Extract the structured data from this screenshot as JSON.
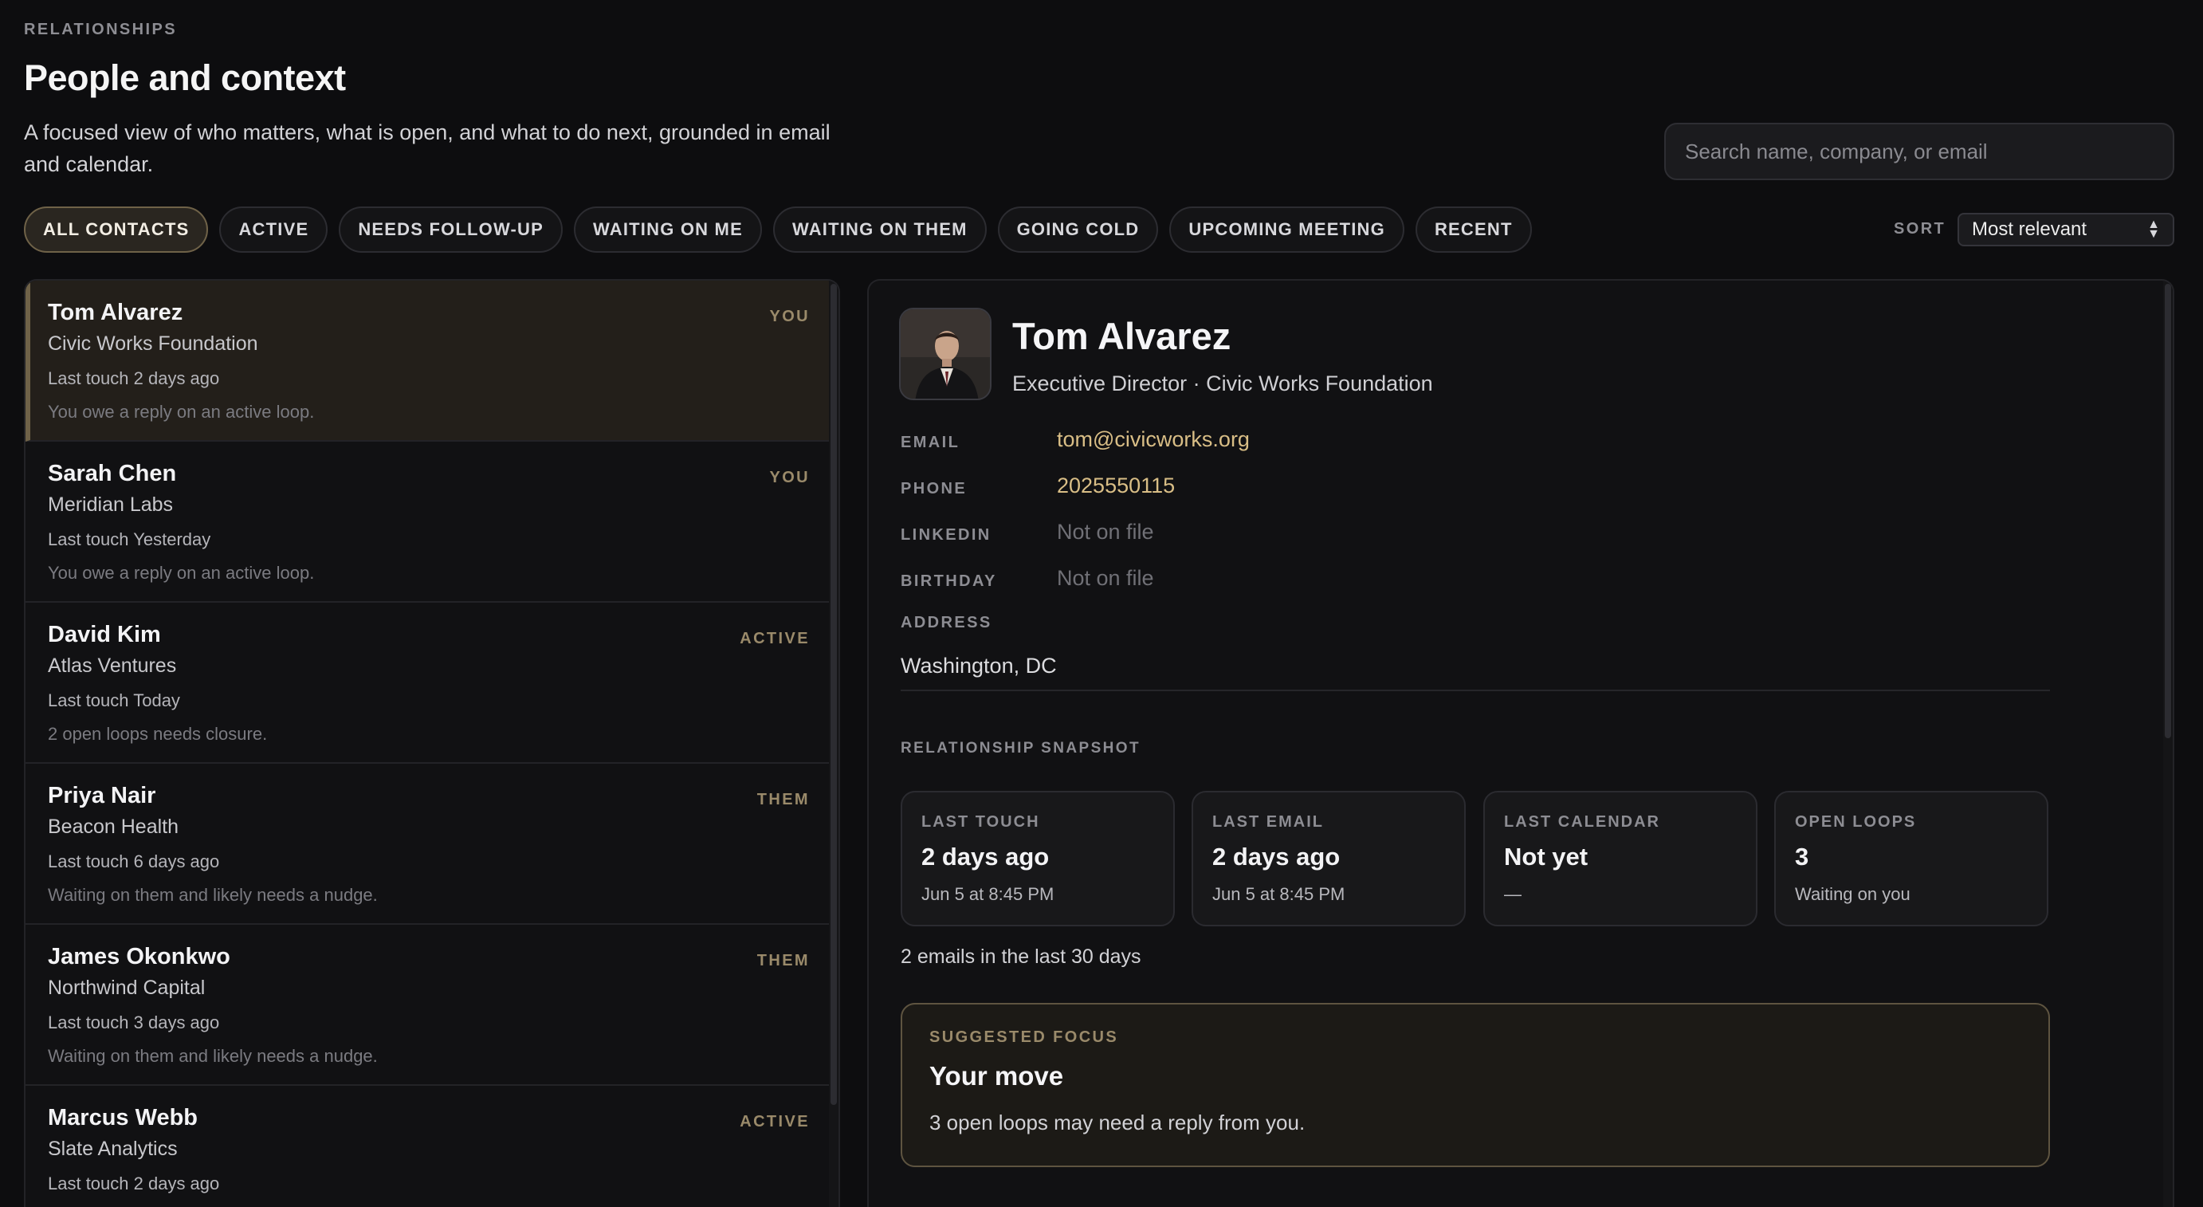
{
  "header": {
    "eyebrow": "RELATIONSHIPS",
    "title": "People and context",
    "description": "A focused view of who matters, what is open, and what to do next, grounded in email and calendar.",
    "search_placeholder": "Search name, company, or email"
  },
  "filters": [
    {
      "label": "ALL CONTACTS",
      "active": true
    },
    {
      "label": "ACTIVE",
      "active": false
    },
    {
      "label": "NEEDS FOLLOW-UP",
      "active": false
    },
    {
      "label": "WAITING ON ME",
      "active": false
    },
    {
      "label": "WAITING ON THEM",
      "active": false
    },
    {
      "label": "GOING COLD",
      "active": false
    },
    {
      "label": "UPCOMING MEETING",
      "active": false
    },
    {
      "label": "RECENT",
      "active": false
    }
  ],
  "sort": {
    "label": "SORT",
    "value": "Most relevant"
  },
  "contacts": [
    {
      "name": "Tom Alvarez",
      "company": "Civic Works Foundation",
      "last_touch": "Last touch 2 days ago",
      "note": "You owe a reply on an active loop.",
      "badge": "YOU",
      "selected": true
    },
    {
      "name": "Sarah Chen",
      "company": "Meridian Labs",
      "last_touch": "Last touch Yesterday",
      "note": "You owe a reply on an active loop.",
      "badge": "YOU",
      "selected": false
    },
    {
      "name": "David Kim",
      "company": "Atlas Ventures",
      "last_touch": "Last touch Today",
      "note": "2 open loops needs closure.",
      "badge": "ACTIVE",
      "selected": false
    },
    {
      "name": "Priya Nair",
      "company": "Beacon Health",
      "last_touch": "Last touch 6 days ago",
      "note": "Waiting on them and likely needs a nudge.",
      "badge": "THEM",
      "selected": false
    },
    {
      "name": "James Okonkwo",
      "company": "Northwind Capital",
      "last_touch": "Last touch 3 days ago",
      "note": "Waiting on them and likely needs a nudge.",
      "badge": "THEM",
      "selected": false
    },
    {
      "name": "Marcus Webb",
      "company": "Slate Analytics",
      "last_touch": "Last touch 2 days ago",
      "note": "",
      "badge": "ACTIVE",
      "selected": false
    }
  ],
  "detail": {
    "name": "Tom Alvarez",
    "role": "Executive Director · Civic Works Foundation",
    "fields": {
      "email_label": "EMAIL",
      "email": "tom@civicworks.org",
      "phone_label": "PHONE",
      "phone": "2025550115",
      "linkedin_label": "LINKEDIN",
      "linkedin": "Not on file",
      "birthday_label": "BIRTHDAY",
      "birthday": "Not on file",
      "address_label": "ADDRESS",
      "address": "Washington, DC"
    },
    "snapshot_label": "RELATIONSHIP SNAPSHOT",
    "stats": [
      {
        "label": "LAST TOUCH",
        "value": "2 days ago",
        "sub": "Jun 5 at 8:45 PM"
      },
      {
        "label": "LAST EMAIL",
        "value": "2 days ago",
        "sub": "Jun 5 at 8:45 PM"
      },
      {
        "label": "LAST CALENDAR",
        "value": "Not yet",
        "sub": "—"
      },
      {
        "label": "OPEN LOOPS",
        "value": "3",
        "sub": "Waiting on you"
      }
    ],
    "emails_summary": "2 emails in the last 30 days",
    "focus": {
      "label": "SUGGESTED FOCUS",
      "title": "Your move",
      "text": "3 open loops may need a reply from you."
    }
  }
}
